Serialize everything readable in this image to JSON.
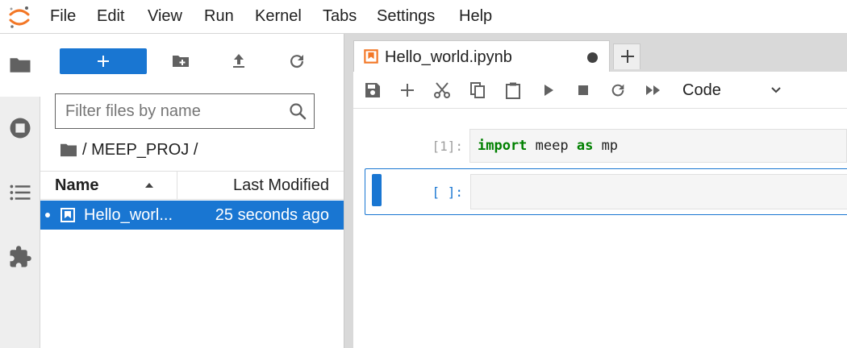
{
  "menubar": {
    "items": [
      "File",
      "Edit",
      "View",
      "Run",
      "Kernel",
      "Tabs",
      "Settings",
      "Help"
    ]
  },
  "activitybar": {
    "icons": [
      "folder-icon",
      "running-icon",
      "toc-icon",
      "extension-icon"
    ]
  },
  "filebrowser": {
    "filter_placeholder": "Filter files by name",
    "breadcrumb": "/ MEEP_PROJ /",
    "columns": {
      "name": "Name",
      "modified": "Last Modified"
    },
    "files": [
      {
        "name": "Hello_worl...",
        "modified": "25 seconds ago"
      }
    ]
  },
  "notebook": {
    "tab_title": "Hello_world.ipynb",
    "cell_type": "Code",
    "cells": [
      {
        "prompt": "[1]:",
        "code": {
          "kw1": "import",
          "mid": " meep ",
          "kw2": "as",
          "rest": " mp"
        }
      },
      {
        "prompt": "[ ]:"
      }
    ]
  },
  "colors": {
    "accent": "#1976d2",
    "logo_orange": "#f37726",
    "keyword_green": "#008000"
  }
}
